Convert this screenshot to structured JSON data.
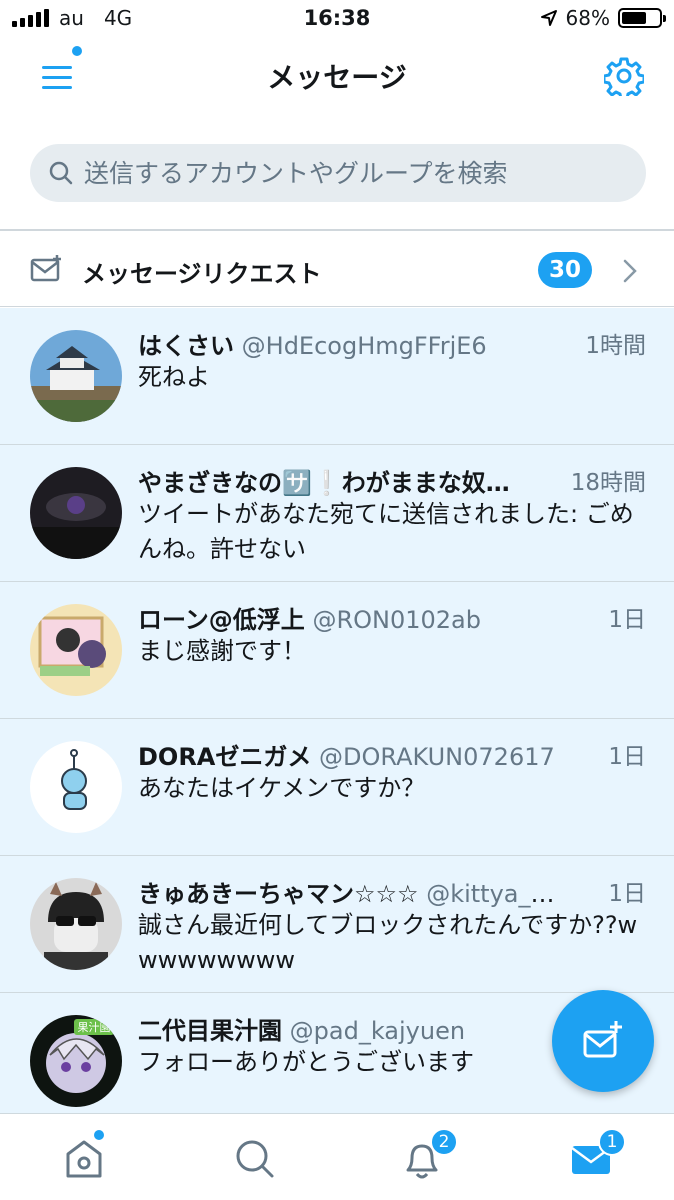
{
  "status_bar": {
    "carrier": "au",
    "network": "4G",
    "time": "16:38",
    "battery": "68%",
    "battery_level": 0.68
  },
  "header": {
    "title": "メッセージ"
  },
  "search": {
    "placeholder": "送信するアカウントやグループを検索"
  },
  "requests": {
    "label": "メッセージリクエスト",
    "count": "30"
  },
  "conversations": [
    {
      "name": "はくさい",
      "handle": "@HdEcogHmgFFrjE6",
      "time": "1時間",
      "message": "死ねよ"
    },
    {
      "name": "やまざきなの🈂️❕わがままな奴…",
      "handle": "",
      "time": "18時間",
      "message": "ツイートがあなた宛てに送信されました: ごめんね。許せない"
    },
    {
      "name": "ローン@低浮上",
      "handle": "@RON0102ab",
      "time": "1日",
      "message": "まじ感謝です！"
    },
    {
      "name": "DORAゼニガメ",
      "handle": "@DORAKUN072617",
      "time": "1日",
      "message": "あなたはイケメンですか？"
    },
    {
      "name": "きゅあきーちゃマン☆☆☆",
      "handle": "@kittya_0…",
      "time": "1日",
      "message": "誠さん最近何してブロックされたんですか??wwwwwwwww"
    },
    {
      "name": "二代目果汁園",
      "handle": "@pad_kajyuen",
      "time": "",
      "message": "フォローありがとうございます"
    }
  ],
  "avatar_badge_text": "果汁園",
  "tabbar": {
    "notifications_badge": "2",
    "messages_badge": "1"
  },
  "colors": {
    "accent": "#1da1f2",
    "list_bg": "#e8f5fe",
    "secondary_text": "#657786"
  }
}
